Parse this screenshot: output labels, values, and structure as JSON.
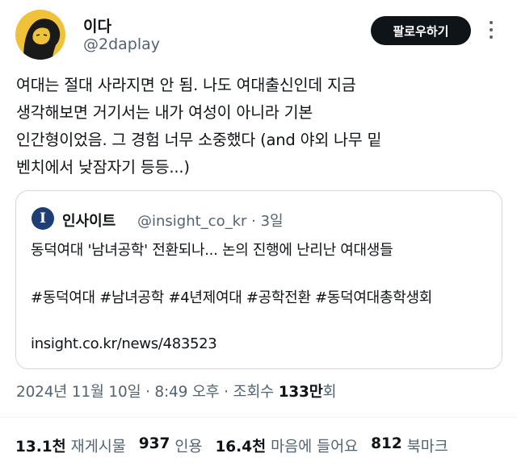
{
  "author": {
    "display_name": "이다",
    "handle": "@2daplay"
  },
  "follow_label": "팔로우하기",
  "tweet_text": "여대는 절대 사라지면 안 됨. 나도 여대출신인데 지금\n생각해보면 거기서는 내가 여성이 아니라 기본\n인간형이었음. 그 경험 너무 소중했다 (and 야외 나무 밑\n벤치에서 낮잠자기 등등...)",
  "quote": {
    "avatar_letter": "I",
    "name": "인사이트",
    "meta": "@insight_co_kr · 3일",
    "headline": "동덕여대 '남녀공학' 전환되나... 논의 진행에 난리난 여대생들",
    "hashtags": "#동덕여대 #남녀공학 #4년제여대 #공학전환 #동덕여대총학생회",
    "link": "insight.co.kr/news/483523"
  },
  "timestamp": {
    "date_time": "2024년 11월 10일 · 8:49 오후 · 조회수 ",
    "views_count": "133만",
    "views_suffix": "회"
  },
  "stats": {
    "reposts_count": "13.1천",
    "reposts_label": "재게시물",
    "quotes_count": "937",
    "quotes_label": "인용",
    "likes_count": "16.4천",
    "likes_label": "마음에 들어요",
    "bookmarks_count": "812",
    "bookmarks_label": "북마크"
  },
  "colors": {
    "primary_text": "#0f1419",
    "secondary_text": "#536471",
    "border": "#cfd9de",
    "follow_button_bg": "#0f1419",
    "avatar_bg": "#f0c23a",
    "quote_avatar_bg": "#1d3f73"
  },
  "icons": [
    "more-icon"
  ]
}
